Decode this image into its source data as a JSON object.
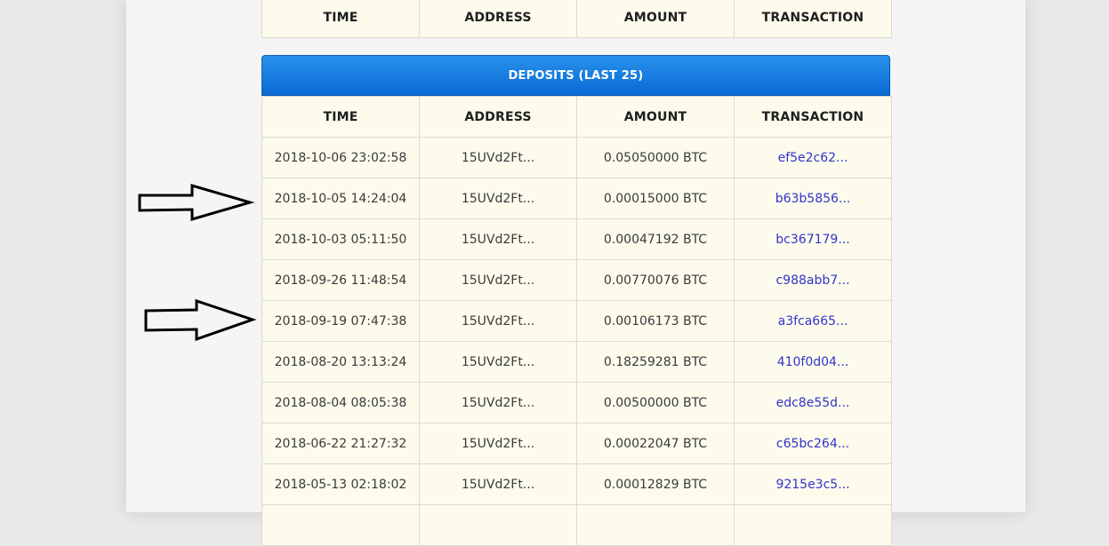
{
  "top_table": {
    "headers": [
      "TIME",
      "ADDRESS",
      "AMOUNT",
      "TRANSACTION"
    ]
  },
  "deposits": {
    "title": "DEPOSITS (LAST 25)",
    "headers": [
      "TIME",
      "ADDRESS",
      "AMOUNT",
      "TRANSACTION"
    ],
    "rows": [
      {
        "time": "2018-10-06 23:02:58",
        "address": "15UVd2Ft...",
        "amount": "0.05050000 BTC",
        "tx": "ef5e2c62..."
      },
      {
        "time": "2018-10-05 14:24:04",
        "address": "15UVd2Ft...",
        "amount": "0.00015000 BTC",
        "tx": "b63b5856..."
      },
      {
        "time": "2018-10-03 05:11:50",
        "address": "15UVd2Ft...",
        "amount": "0.00047192 BTC",
        "tx": "bc367179..."
      },
      {
        "time": "2018-09-26 11:48:54",
        "address": "15UVd2Ft...",
        "amount": "0.00770076 BTC",
        "tx": "c988abb7..."
      },
      {
        "time": "2018-09-19 07:47:38",
        "address": "15UVd2Ft...",
        "amount": "0.00106173 BTC",
        "tx": "a3fca665..."
      },
      {
        "time": "2018-08-20 13:13:24",
        "address": "15UVd2Ft...",
        "amount": "0.18259281 BTC",
        "tx": "410f0d04..."
      },
      {
        "time": "2018-08-04 08:05:38",
        "address": "15UVd2Ft...",
        "amount": "0.00500000 BTC",
        "tx": "edc8e55d..."
      },
      {
        "time": "2018-06-22 21:27:32",
        "address": "15UVd2Ft...",
        "amount": "0.00022047 BTC",
        "tx": "c65bc264..."
      },
      {
        "time": "2018-05-13 02:18:02",
        "address": "15UVd2Ft...",
        "amount": "0.00012829 BTC",
        "tx": "9215e3c5..."
      },
      {
        "time": "",
        "address": "",
        "amount": "",
        "tx": ""
      }
    ]
  },
  "annotations": {
    "arrow_icon": "right-arrow-outline-icon",
    "arrow_color": "#000000"
  },
  "colors": {
    "header_blue": "#0a6ad3",
    "cell_background": "#fcfbec",
    "link": "#3333cc"
  }
}
